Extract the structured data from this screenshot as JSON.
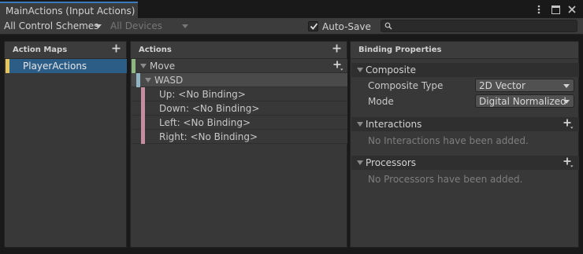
{
  "window": {
    "tab_title": "MainActions (Input Actions)",
    "buttons": [
      "more-icon",
      "maximize-icon",
      "close-icon"
    ]
  },
  "toolbar": {
    "control_schemes": "All Control Schemes",
    "devices": "All Devices",
    "auto_save_label": "Auto-Save",
    "auto_save_checked": true,
    "search_placeholder": ""
  },
  "action_maps": {
    "header": "Action Maps",
    "items": [
      {
        "label": "PlayerActions",
        "selected": true
      }
    ]
  },
  "actions": {
    "header": "Actions",
    "action": {
      "label": "Move"
    },
    "composite": {
      "label": "WASD"
    },
    "parts": [
      {
        "label": "Up: <No Binding>"
      },
      {
        "label": "Down: <No Binding>"
      },
      {
        "label": "Left: <No Binding>"
      },
      {
        "label": "Right: <No Binding>"
      }
    ]
  },
  "binding_properties": {
    "header": "Binding Properties",
    "composite": {
      "title": "Composite",
      "type_label": "Composite Type",
      "type_value": "2D Vector",
      "mode_label": "Mode",
      "mode_value": "Digital Normalized"
    },
    "interactions": {
      "title": "Interactions",
      "empty": "No Interactions have been added."
    },
    "processors": {
      "title": "Processors",
      "empty": "No Processors have been added."
    }
  },
  "colors": {
    "selection": "#2c5d87",
    "map_stripe": "#e6c65a",
    "action_stripe": "#8fb780",
    "composite_stripe": "#8fb4c4",
    "part_stripe": "#c58da0",
    "tab_accent": "#3a79bb"
  }
}
